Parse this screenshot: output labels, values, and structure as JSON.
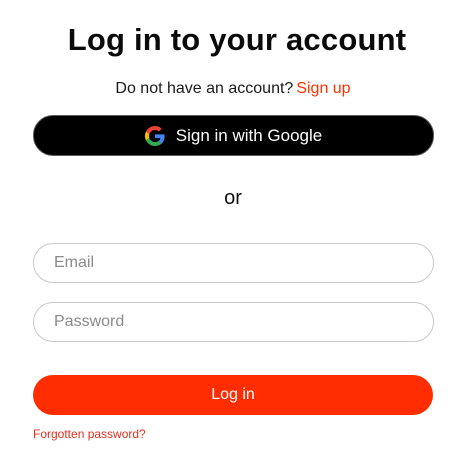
{
  "header": {
    "title": "Log in to your account"
  },
  "signup": {
    "prompt": "Do not have an account?",
    "link_label": "Sign up"
  },
  "google": {
    "button_label": "Sign in with Google",
    "icon": "google-g-icon"
  },
  "divider": {
    "label": "or"
  },
  "form": {
    "email": {
      "value": "",
      "placeholder": "Email"
    },
    "password": {
      "value": "",
      "placeholder": "Password"
    },
    "login_label": "Log in",
    "forgot_label": "Forgotten password?"
  },
  "colors": {
    "accent": "#ff2d00",
    "link": "#ff3300",
    "google_button_bg": "#000000"
  }
}
